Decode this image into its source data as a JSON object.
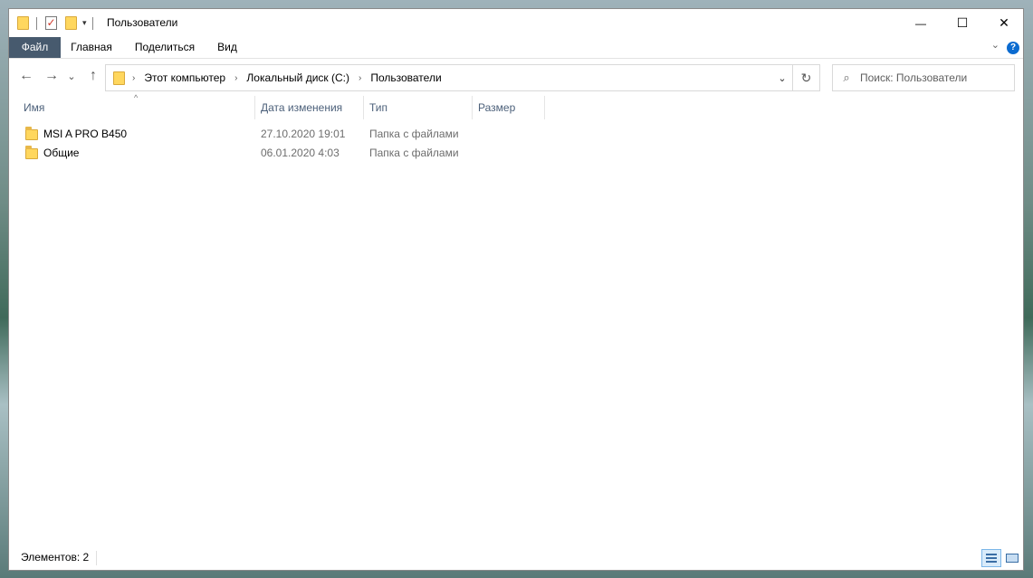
{
  "window": {
    "title": "Пользователи",
    "controls": {
      "minimize": "—",
      "maximize": "☐",
      "close": "✕"
    }
  },
  "ribbon": {
    "tabs": [
      "Файл",
      "Главная",
      "Поделиться",
      "Вид"
    ],
    "help": "?"
  },
  "navigation": {
    "back": "←",
    "forward": "→",
    "recent": "⌄",
    "up": "↑",
    "breadcrumbs": [
      "Этот компьютер",
      "Локальный диск (C:)",
      "Пользователи"
    ],
    "refresh": "↻"
  },
  "search": {
    "placeholder": "Поиск: Пользователи"
  },
  "columns": [
    "Имя",
    "Дата изменения",
    "Тип",
    "Размер"
  ],
  "files": [
    {
      "name": "MSI A PRO B450",
      "date": "27.10.2020 19:01",
      "type": "Папка с файлами"
    },
    {
      "name": "Общие",
      "date": "06.01.2020 4:03",
      "type": "Папка с файлами"
    }
  ],
  "status": {
    "count": "Элементов: 2"
  }
}
